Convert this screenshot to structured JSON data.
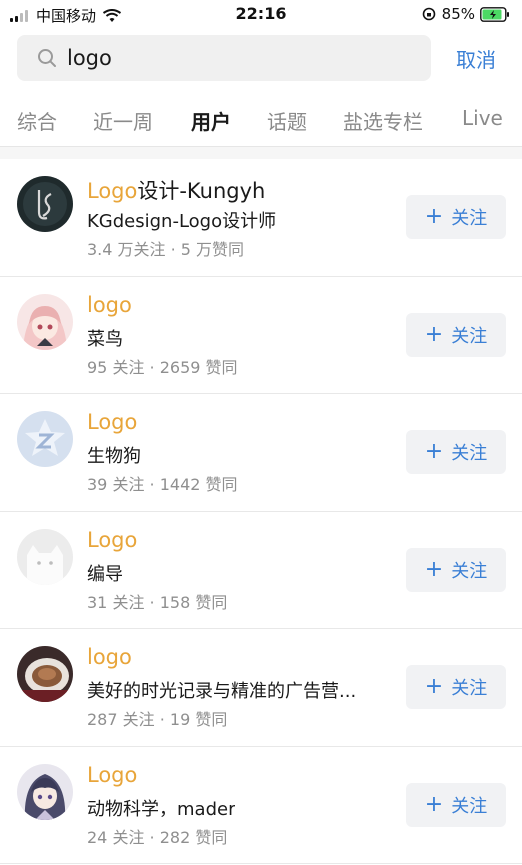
{
  "status_bar": {
    "carrier": "中国移动",
    "time": "22:16",
    "battery": "85%"
  },
  "search": {
    "query": "logo",
    "cancel_label": "取消"
  },
  "tabs": [
    "综合",
    "近一周",
    "用户",
    "话题",
    "盐选专栏",
    "Live"
  ],
  "active_tab": "用户",
  "follow_label": "关注",
  "users": [
    {
      "name_highlight": "Logo",
      "name_rest": "设计-Kungyh",
      "bio": "KGdesign-Logo设计师",
      "stats": "3.4 万关注 · 5 万赞同"
    },
    {
      "name_highlight": "logo",
      "name_rest": "",
      "bio": "菜鸟",
      "stats": "95 关注 · 2659 赞同"
    },
    {
      "name_highlight": "Logo",
      "name_rest": "",
      "bio": "生物狗",
      "stats": "39 关注 · 1442 赞同"
    },
    {
      "name_highlight": "Logo",
      "name_rest": "",
      "bio": "编导",
      "stats": "31 关注 · 158 赞同"
    },
    {
      "name_highlight": "logo",
      "name_rest": "",
      "bio": "美好的时光记录与精准的广告营...",
      "stats": "287 关注 · 19 赞同"
    },
    {
      "name_highlight": "Logo",
      "name_rest": "",
      "bio": "动物科学，mader",
      "stats": "24 关注 · 282 赞同"
    }
  ],
  "colors": {
    "highlight": "#e8a53a",
    "accent": "#3a7fd5"
  }
}
